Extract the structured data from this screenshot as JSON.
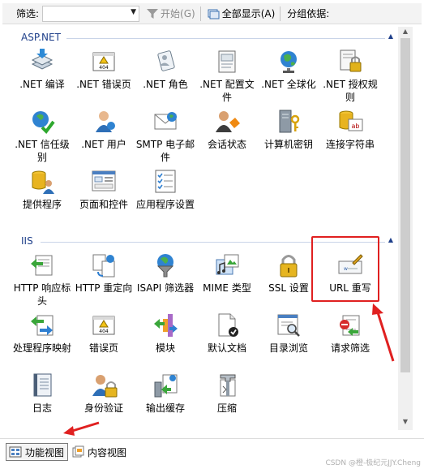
{
  "toolbar": {
    "filter_label": "筛选:",
    "filter_value": "",
    "start_label": "开始(G)",
    "show_all_label": "全部显示(A)",
    "group_by_label": "分组依据:"
  },
  "groups": [
    {
      "title": "ASP.NET",
      "items": [
        {
          "label": ".NET 编译",
          "icon": "compile-icon"
        },
        {
          "label": ".NET 错误页",
          "icon": "error-page-icon"
        },
        {
          "label": ".NET 角色",
          "icon": "roles-icon"
        },
        {
          "label": ".NET 配置文件",
          "icon": "profile-icon"
        },
        {
          "label": ".NET 全球化",
          "icon": "globe-icon"
        },
        {
          "label": ".NET 授权规则",
          "icon": "auth-rules-icon"
        },
        {
          "label": ".NET 信任级别",
          "icon": "trust-level-icon"
        },
        {
          "label": ".NET 用户",
          "icon": "users-icon"
        },
        {
          "label": "SMTP 电子邮件",
          "icon": "smtp-icon"
        },
        {
          "label": "会话状态",
          "icon": "session-state-icon"
        },
        {
          "label": "计算机密钥",
          "icon": "machine-key-icon"
        },
        {
          "label": "连接字符串",
          "icon": "connection-string-icon"
        },
        {
          "label": "提供程序",
          "icon": "providers-icon"
        },
        {
          "label": "页面和控件",
          "icon": "pages-controls-icon"
        },
        {
          "label": "应用程序设置",
          "icon": "app-settings-icon"
        }
      ]
    },
    {
      "title": "IIS",
      "items": [
        {
          "label": "HTTP 响应标头",
          "icon": "http-headers-icon"
        },
        {
          "label": "HTTP 重定向",
          "icon": "http-redirect-icon"
        },
        {
          "label": "ISAPI 筛选器",
          "icon": "isapi-filter-icon"
        },
        {
          "label": "MIME 类型",
          "icon": "mime-types-icon"
        },
        {
          "label": "SSL 设置",
          "icon": "ssl-lock-icon"
        },
        {
          "label": "URL 重写",
          "icon": "url-rewrite-icon"
        },
        {
          "label": "处理程序映射",
          "icon": "handler-mappings-icon"
        },
        {
          "label": "错误页",
          "icon": "error-page-icon"
        },
        {
          "label": "模块",
          "icon": "modules-icon"
        },
        {
          "label": "默认文档",
          "icon": "default-document-icon"
        },
        {
          "label": "目录浏览",
          "icon": "directory-browsing-icon"
        },
        {
          "label": "请求筛选",
          "icon": "request-filtering-icon"
        },
        {
          "label": "日志",
          "icon": "logging-icon"
        },
        {
          "label": "身份验证",
          "icon": "authentication-icon"
        },
        {
          "label": "输出缓存",
          "icon": "output-cache-icon"
        },
        {
          "label": "压缩",
          "icon": "compression-icon"
        }
      ]
    }
  ],
  "tabs": {
    "features_view": "功能视图",
    "content_view": "内容视图"
  },
  "watermark": "CSDN @橙-极纪元JJY.Cheng",
  "colors": {
    "group_title": "#1e3f8a",
    "annotation": "#e02020"
  }
}
